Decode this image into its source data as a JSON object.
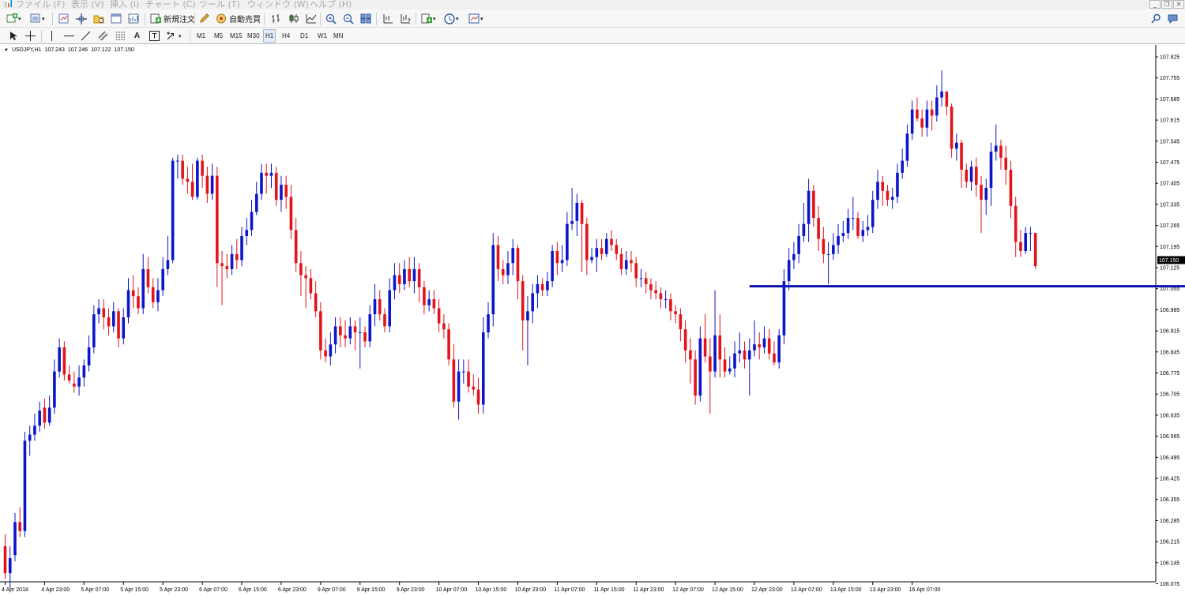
{
  "menu": {
    "items": [
      "ファイル (F)",
      "表示 (V)",
      "挿入 (I)",
      "チャート (C)",
      "ツール (T)",
      "ウィンドウ (W)",
      "ヘルプ (H)"
    ]
  },
  "toolbar": {
    "new_order_label": "新規注文",
    "auto_trade_label": "自動売買"
  },
  "timeframes": [
    "M1",
    "M5",
    "M15",
    "M30",
    "H1",
    "H4",
    "D1",
    "W1",
    "MN"
  ],
  "active_timeframe": "H1",
  "chart_header": {
    "symbol": "USDJPY,H1",
    "open": "107.243",
    "high": "107.246",
    "low": "107.122",
    "close": "107.150"
  },
  "current_price_label": "107.150",
  "colors": {
    "bull": "#0b16c8",
    "bear": "#e2141a",
    "horizontal_line": "#0d12a6",
    "price_tag_bg": "#000000"
  },
  "chart_data": {
    "type": "candlestick",
    "symbol": "USDJPY",
    "timeframe": "H1",
    "ylim": [
      106.095,
      107.81
    ],
    "y_ticks": [
      "107.825",
      "107.755",
      "107.685",
      "107.615",
      "107.545",
      "107.475",
      "107.405",
      "107.335",
      "107.265",
      "107.195",
      "107.125",
      "107.055",
      "106.985",
      "106.915",
      "106.845",
      "106.775",
      "106.705",
      "106.635",
      "106.565",
      "106.495",
      "106.425",
      "106.355",
      "106.285",
      "106.215",
      "106.145",
      "106.075"
    ],
    "x_ticks": [
      "4 Apr 2018",
      "4 Apr 23:00",
      "5 Apr 07:00",
      "5 Apr 15:00",
      "5 Apr 23:00",
      "6 Apr 07:00",
      "6 Apr 15:00",
      "6 Apr 23:00",
      "9 Apr 07:00",
      "9 Apr 15:00",
      "9 Apr 23:00",
      "10 Apr 07:00",
      "10 Apr 15:00",
      "10 Apr 23:00",
      "11 Apr 07:00",
      "11 Apr 15:00",
      "11 Apr 23:00",
      "12 Apr 07:00",
      "12 Apr 15:00",
      "12 Apr 23:00",
      "13 Apr 07:00",
      "13 Apr 15:00",
      "13 Apr 23:00",
      "16 Apr 07:00"
    ],
    "horizontal_line": 107.063,
    "horizontal_line_range": {
      "start_bar": 151,
      "end_bar": 258
    },
    "bars_per_tick": 8,
    "closes": [
      106.11,
      106.16,
      106.28,
      106.25,
      106.55,
      106.57,
      106.6,
      106.65,
      106.61,
      106.66,
      106.78,
      106.86,
      106.77,
      106.75,
      106.73,
      106.76,
      106.8,
      106.86,
      106.97,
      106.99,
      106.96,
      106.93,
      106.98,
      106.89,
      106.96,
      107.05,
      107.03,
      106.99,
      107.12,
      107.06,
      107.01,
      107.05,
      107.12,
      107.15,
      107.48,
      107.48,
      107.42,
      107.41,
      107.36,
      107.48,
      107.43,
      107.37,
      107.43,
      107.14,
      107.13,
      107.12,
      107.17,
      107.15,
      107.23,
      107.25,
      107.31,
      107.37,
      107.44,
      107.43,
      107.44,
      107.35,
      107.4,
      107.36,
      107.25,
      107.14,
      107.1,
      107.09,
      107.04,
      106.98,
      106.85,
      106.83,
      106.87,
      106.93,
      106.9,
      106.89,
      106.93,
      106.91,
      106.91,
      106.88,
      106.97,
      107.02,
      106.97,
      106.93,
      107.05,
      107.1,
      107.07,
      107.12,
      107.08,
      107.12,
      107.06,
      107.0,
      107.02,
      106.99,
      106.94,
      106.92,
      106.82,
      106.68,
      106.78,
      106.78,
      106.73,
      106.72,
      106.67,
      106.91,
      106.97,
      107.2,
      107.12,
      107.1,
      107.14,
      107.19,
      107.08,
      106.95,
      106.98,
      107.04,
      107.07,
      107.05,
      107.08,
      107.18,
      107.14,
      107.15,
      107.27,
      107.28,
      107.34,
      107.27,
      107.15,
      107.16,
      107.19,
      107.17,
      107.22,
      107.2,
      107.17,
      107.12,
      107.15,
      107.14,
      107.09,
      107.09,
      107.07,
      107.05,
      107.04,
      107.02,
      107.02,
      106.98,
      106.97,
      106.92,
      106.85,
      106.82,
      106.7,
      106.89,
      106.83,
      106.78,
      106.9,
      106.82,
      106.78,
      106.79,
      106.84,
      106.85,
      106.82,
      106.85,
      106.87,
      106.86,
      106.89,
      106.84,
      106.81,
      106.9,
      107.08,
      107.15,
      107.17,
      107.23,
      107.27,
      107.38,
      107.29,
      107.22,
      107.17,
      107.17,
      107.2,
      107.23,
      107.24,
      107.29,
      107.29,
      107.23,
      107.25,
      107.26,
      107.35,
      107.41,
      107.38,
      107.35,
      107.36,
      107.44,
      107.48,
      107.57,
      107.65,
      107.62,
      107.59,
      107.65,
      107.63,
      107.69,
      107.71,
      107.66,
      107.52,
      107.54,
      107.45,
      107.41,
      107.46,
      107.4,
      107.35,
      107.39,
      107.51,
      107.53,
      107.49,
      107.45,
      107.33,
      107.21,
      107.18,
      107.24,
      107.24,
      107.13
    ],
    "opens": [
      106.2,
      106.11,
      106.17,
      106.28,
      106.25,
      106.55,
      106.57,
      106.6,
      106.66,
      106.61,
      106.66,
      106.78,
      106.86,
      106.77,
      106.74,
      106.73,
      106.76,
      106.8,
      106.86,
      106.97,
      106.99,
      106.96,
      106.93,
      106.98,
      106.89,
      106.96,
      107.05,
      107.03,
      106.99,
      107.12,
      107.06,
      107.01,
      107.05,
      107.12,
      107.15,
      107.48,
      107.48,
      107.42,
      107.41,
      107.36,
      107.48,
      107.43,
      107.37,
      107.43,
      107.14,
      107.13,
      107.12,
      107.17,
      107.15,
      107.23,
      107.25,
      107.31,
      107.37,
      107.44,
      107.43,
      107.44,
      107.35,
      107.4,
      107.36,
      107.25,
      107.14,
      107.1,
      107.09,
      107.04,
      106.98,
      106.85,
      106.83,
      106.87,
      106.93,
      106.9,
      106.89,
      106.93,
      106.91,
      106.91,
      106.88,
      106.97,
      107.02,
      106.97,
      106.93,
      107.05,
      107.1,
      107.07,
      107.12,
      107.08,
      107.12,
      107.06,
      107.0,
      107.02,
      106.99,
      106.94,
      106.92,
      106.82,
      106.68,
      106.78,
      106.78,
      106.73,
      106.72,
      106.67,
      106.91,
      106.97,
      107.2,
      107.12,
      107.1,
      107.14,
      107.19,
      107.08,
      106.95,
      106.98,
      107.04,
      107.07,
      107.05,
      107.08,
      107.18,
      107.14,
      107.15,
      107.27,
      107.28,
      107.34,
      107.27,
      107.15,
      107.16,
      107.19,
      107.17,
      107.22,
      107.2,
      107.17,
      107.12,
      107.15,
      107.14,
      107.09,
      107.09,
      107.07,
      107.05,
      107.04,
      107.02,
      107.02,
      106.98,
      106.97,
      106.92,
      106.85,
      106.82,
      106.7,
      106.89,
      106.83,
      106.78,
      106.9,
      106.82,
      106.78,
      106.79,
      106.84,
      106.85,
      106.82,
      106.85,
      106.87,
      106.86,
      106.89,
      106.84,
      106.81,
      106.9,
      107.08,
      107.15,
      107.17,
      107.23,
      107.27,
      107.38,
      107.29,
      107.22,
      107.17,
      107.17,
      107.2,
      107.23,
      107.24,
      107.29,
      107.29,
      107.23,
      107.25,
      107.26,
      107.35,
      107.41,
      107.38,
      107.35,
      107.36,
      107.44,
      107.48,
      107.57,
      107.65,
      107.62,
      107.59,
      107.65,
      107.63,
      107.69,
      107.71,
      107.66,
      107.52,
      107.54,
      107.45,
      107.41,
      107.46,
      107.4,
      107.35,
      107.39,
      107.51,
      107.53,
      107.49,
      107.45,
      107.33,
      107.21,
      107.18,
      107.24,
      107.24
    ],
    "highs": [
      106.24,
      106.2,
      106.31,
      106.33,
      106.58,
      106.6,
      106.64,
      106.68,
      106.69,
      106.7,
      106.82,
      106.89,
      106.88,
      106.8,
      106.78,
      106.8,
      106.82,
      106.9,
      107.0,
      107.02,
      107.02,
      106.99,
      107.01,
      106.99,
      106.99,
      107.09,
      107.1,
      107.06,
      107.17,
      107.16,
      107.09,
      107.09,
      107.16,
      107.23,
      107.49,
      107.5,
      107.5,
      107.46,
      107.47,
      107.49,
      107.5,
      107.46,
      107.47,
      107.46,
      107.18,
      107.17,
      107.2,
      107.22,
      107.26,
      107.29,
      107.35,
      107.41,
      107.47,
      107.47,
      107.47,
      107.46,
      107.43,
      107.43,
      107.4,
      107.29,
      107.18,
      107.13,
      107.12,
      107.08,
      107.01,
      106.89,
      106.91,
      106.96,
      106.96,
      106.95,
      106.96,
      106.95,
      106.96,
      106.93,
      107.0,
      107.07,
      107.05,
      106.99,
      107.09,
      107.14,
      107.14,
      107.15,
      107.16,
      107.16,
      107.14,
      107.08,
      107.05,
      107.05,
      107.02,
      106.97,
      106.94,
      106.87,
      106.82,
      106.82,
      106.82,
      106.77,
      106.76,
      106.96,
      107.01,
      107.24,
      107.23,
      107.15,
      107.18,
      107.22,
      107.2,
      107.1,
      107.03,
      107.07,
      107.1,
      107.09,
      107.11,
      107.2,
      107.21,
      107.2,
      107.31,
      107.39,
      107.37,
      107.35,
      107.29,
      107.19,
      107.22,
      107.22,
      107.24,
      107.25,
      107.22,
      107.19,
      107.18,
      107.18,
      107.16,
      107.12,
      107.11,
      107.09,
      107.08,
      107.06,
      107.05,
      107.04,
      107.0,
      106.99,
      106.95,
      106.89,
      106.85,
      106.93,
      106.97,
      106.89,
      107.05,
      106.97,
      106.86,
      106.83,
      106.88,
      106.91,
      106.88,
      106.89,
      106.95,
      106.91,
      106.93,
      106.92,
      106.88,
      106.92,
      107.12,
      107.19,
      107.21,
      107.27,
      107.34,
      107.42,
      107.4,
      107.33,
      107.26,
      107.21,
      107.24,
      107.27,
      107.28,
      107.32,
      107.36,
      107.31,
      107.28,
      107.3,
      107.38,
      107.45,
      107.43,
      107.4,
      107.39,
      107.47,
      107.52,
      107.6,
      107.68,
      107.69,
      107.65,
      107.68,
      107.68,
      107.73,
      107.78,
      107.71,
      107.67,
      107.57,
      107.55,
      107.47,
      107.48,
      107.49,
      107.43,
      107.42,
      107.54,
      107.6,
      107.55,
      107.53,
      107.48,
      107.36,
      107.25,
      107.26,
      107.26,
      107.24
    ],
    "lows": [
      106.09,
      106.06,
      106.15,
      106.23,
      106.23,
      106.5,
      106.55,
      106.58,
      106.59,
      106.6,
      106.64,
      106.76,
      106.75,
      106.74,
      106.71,
      106.7,
      106.73,
      106.78,
      106.84,
      106.94,
      106.92,
      106.9,
      106.91,
      106.86,
      106.87,
      106.94,
      106.99,
      106.97,
      106.97,
      107.04,
      106.99,
      106.98,
      107.03,
      107.1,
      107.14,
      107.42,
      107.4,
      107.37,
      107.35,
      107.35,
      107.39,
      107.34,
      107.35,
      107.06,
      107.0,
      107.09,
      107.1,
      107.12,
      107.13,
      107.2,
      107.23,
      107.3,
      107.35,
      107.37,
      107.39,
      107.33,
      107.31,
      107.32,
      107.22,
      107.11,
      107.03,
      106.99,
      107.02,
      106.96,
      106.82,
      106.81,
      106.8,
      106.84,
      106.86,
      106.86,
      106.87,
      106.85,
      106.79,
      106.86,
      106.86,
      106.93,
      106.95,
      106.91,
      106.91,
      107.02,
      107.04,
      107.05,
      107.06,
      107.04,
      107.01,
      106.97,
      106.98,
      106.97,
      106.91,
      106.89,
      106.8,
      106.66,
      106.62,
      106.74,
      106.71,
      106.7,
      106.64,
      106.64,
      106.89,
      106.93,
      107.08,
      107.07,
      107.07,
      107.1,
      107.02,
      106.85,
      106.8,
      106.94,
      106.99,
      107.03,
      107.03,
      107.06,
      107.1,
      107.11,
      107.13,
      107.25,
      107.23,
      107.11,
      107.1,
      107.14,
      107.11,
      107.15,
      107.16,
      107.18,
      107.15,
      107.1,
      107.1,
      107.11,
      107.06,
      107.06,
      107.04,
      107.02,
      107.02,
      106.99,
      106.99,
      106.95,
      106.94,
      106.88,
      106.81,
      106.74,
      106.67,
      106.68,
      106.81,
      106.64,
      106.76,
      106.76,
      106.76,
      106.77,
      106.76,
      106.81,
      106.79,
      106.7,
      106.83,
      106.82,
      106.84,
      106.82,
      106.8,
      106.79,
      106.87,
      107.05,
      107.12,
      107.14,
      107.21,
      107.21,
      107.26,
      107.18,
      107.14,
      107.07,
      107.15,
      107.17,
      107.21,
      107.22,
      107.25,
      107.22,
      107.21,
      107.23,
      107.24,
      107.32,
      107.33,
      107.33,
      107.32,
      107.34,
      107.42,
      107.46,
      107.55,
      107.61,
      107.56,
      107.56,
      107.58,
      107.61,
      107.66,
      107.63,
      107.49,
      107.48,
      107.39,
      107.39,
      107.38,
      107.36,
      107.24,
      107.3,
      107.33,
      107.48,
      107.45,
      107.4,
      107.29,
      107.16,
      107.16,
      107.17,
      107.18,
      107.12
    ]
  }
}
